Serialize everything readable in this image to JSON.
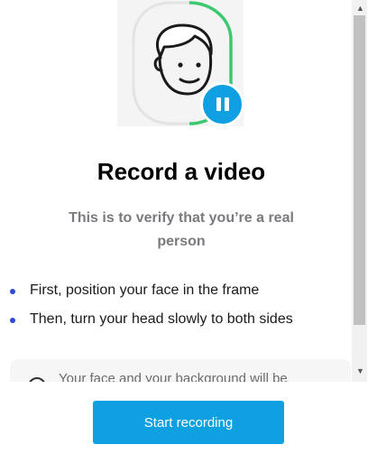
{
  "illustration": {
    "face_icon": "face-outline-icon",
    "pause_icon": "pause-icon",
    "progress_color": "#3cc86e",
    "accent": "#0ea0e0"
  },
  "title": "Record a video",
  "subtitle": "This is to verify that you’re a real person",
  "steps": [
    {
      "text": "First, position your face in the frame"
    },
    {
      "text": "Then, turn your head slowly to both sides"
    }
  ],
  "notice": {
    "icon": "info-icon",
    "text": "Your face and your background will be recorded"
  },
  "scrollbar": {
    "up_icon": "▲",
    "down_icon": "▼"
  },
  "footer": {
    "button_label": "Start recording"
  }
}
